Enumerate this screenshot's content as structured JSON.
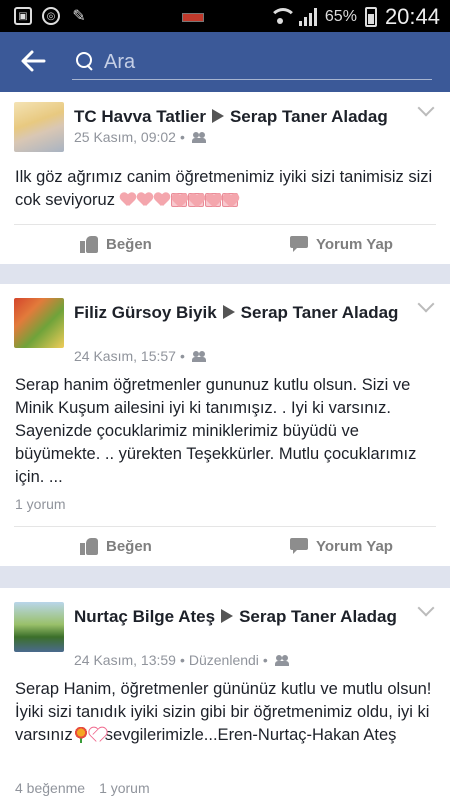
{
  "status_bar": {
    "battery_percent": "65%",
    "time": "20:44",
    "icons": [
      "gallery-icon",
      "sync-icon",
      "broom-icon",
      "battery-indicator-icon",
      "wifi-icon",
      "signal-icon",
      "battery-icon"
    ]
  },
  "header": {
    "back_icon": "arrow-left-icon",
    "search_placeholder": "Ara",
    "background_color": "#3b5998"
  },
  "posts": [
    {
      "author": "TC Havva Tatlier",
      "target": "Serap Taner Aladag",
      "time": "25 Kasım, 09:02",
      "separator": "•",
      "privacy_icon": "friends-icon",
      "text": "Ilk göz ağrımız canim öğretmenimiz iyiki sizi tanimisiz sizi cok seviyoruz",
      "emoji_icons": [
        "heart-icon",
        "heart-icon",
        "heart-icon",
        "heart-boxed-icon",
        "heart-boxed-icon",
        "heart-boxed-icon",
        "heart-boxed-icon"
      ],
      "like_label": "Beğen",
      "comment_label": "Yorum Yap"
    },
    {
      "author": "Filiz Gürsoy Biyik",
      "target": "Serap Taner Aladag",
      "time": "24 Kasım, 15:57",
      "separator": "•",
      "privacy_icon": "friends-icon",
      "text": "Serap hanim  öğretmenler  gununuz kutlu olsun.  Sizi ve Minik Kuşum ailesini iyi ki tanımışız. . Iyi ki varsınız.  Sayenizde  çocuklarimiz miniklerimiz büyüdü  ve büyümekte.  .. yürekten  Teşekkürler. Mutlu çocuklarımız için. ...",
      "comments_count": "1 yorum",
      "like_label": "Beğen",
      "comment_label": "Yorum Yap"
    },
    {
      "author": "Nurtaç Bilge Ateş",
      "target": "Serap Taner Aladag",
      "time": "24 Kasım, 13:59",
      "separator": "•",
      "edited": "Düzenlendi",
      "privacy_icon": "friends-icon",
      "text_part1": "Serap Hanim, öğretmenler gününüz kutlu ve mutlu olsun!İyiki sizi tanıdık iyiki sizin gibi bir öğretmenimiz oldu, iyi ki varsınız",
      "text_part2": "sevgilerimizle...Eren-Nurtaç-Hakan Ateş",
      "likes_count": "4 beğenme",
      "comments_count": "1 yorum"
    }
  ]
}
